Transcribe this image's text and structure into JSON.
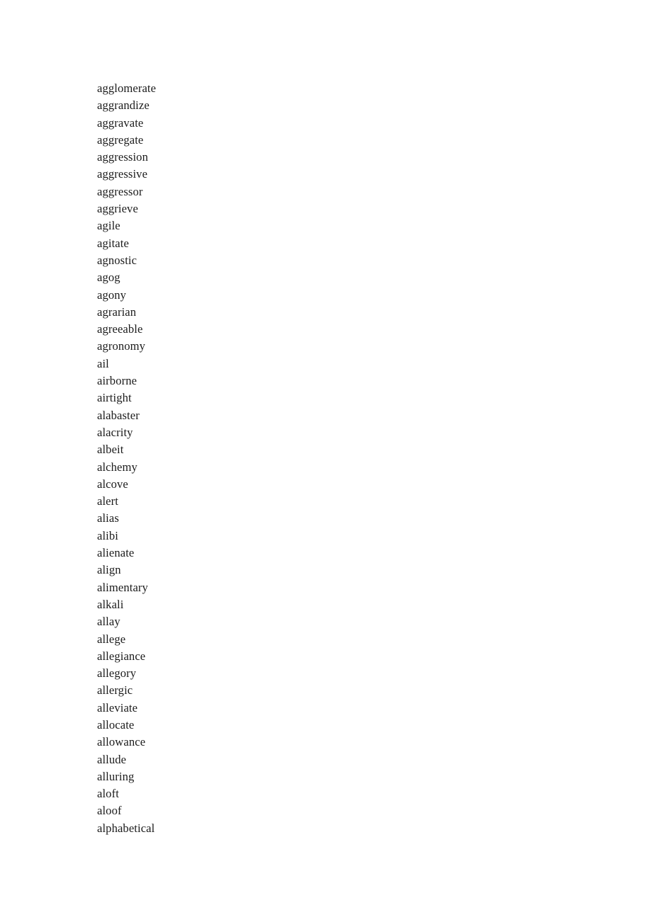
{
  "document": {
    "background_color": "#ffffff",
    "text_color": "#1c1c1c",
    "word_list": [
      "agglomerate",
      "aggrandize",
      "aggravate",
      "aggregate",
      "aggression",
      "aggressive",
      "aggressor",
      "aggrieve",
      "agile",
      "agitate",
      "agnostic",
      "agog",
      "agony",
      "agrarian",
      "agreeable",
      "agronomy",
      "ail",
      "airborne",
      "airtight",
      "alabaster",
      "alacrity",
      "albeit",
      "alchemy",
      "alcove",
      "alert",
      "alias",
      "alibi",
      "alienate",
      "align",
      "alimentary",
      "alkali",
      "allay",
      "allege",
      "allegiance",
      "allegory",
      "allergic",
      "alleviate",
      "allocate",
      "allowance",
      "allude",
      "alluring",
      "aloft",
      "aloof",
      "alphabetical"
    ]
  }
}
